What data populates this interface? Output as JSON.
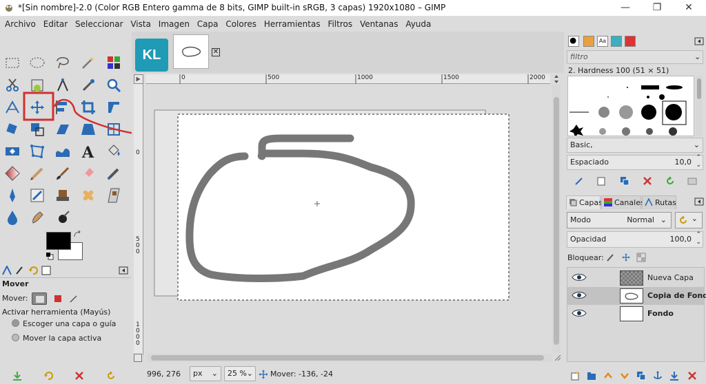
{
  "window": {
    "title": "*[Sin nombre]-2.0 (Color RGB Entero gamma de 8 bits, GIMP built-in sRGB, 3 capas) 1920x1080 – GIMP",
    "minimize": "—",
    "maximize": "❐",
    "close": "✕"
  },
  "menu": [
    "Archivo",
    "Editar",
    "Seleccionar",
    "Vista",
    "Imagen",
    "Capa",
    "Colores",
    "Herramientas",
    "Filtros",
    "Ventanas",
    "Ayuda"
  ],
  "image_tabs": {
    "logo_text": "KL"
  },
  "rulers": {
    "h_ticks": [
      "0",
      "500",
      "1000",
      "1500",
      "2000"
    ],
    "v_ticks": [
      "0",
      "5\n0\n0",
      "1\n0\n0\n0"
    ]
  },
  "tool_options": {
    "title": "Mover",
    "mover_label": "Mover:",
    "toggle_label": "Activar herramienta  (Mayús)",
    "radio1": "Escoger una capa o guía",
    "radio2": "Mover la capa activa"
  },
  "status": {
    "coords": "996, 276",
    "unit": "px",
    "zoom": "25 %",
    "message": "Mover: -136, -24"
  },
  "brushes": {
    "filter_placeholder": "filtro",
    "current": "2. Hardness 100 (51 × 51)",
    "preset": "Basic,",
    "spacing_label": "Espaciado",
    "spacing_value": "10,0"
  },
  "layers": {
    "tabs": [
      "Capas",
      "Canales",
      "Rutas"
    ],
    "mode_label": "Modo",
    "mode_value": "Normal",
    "opacity_label": "Opacidad",
    "opacity_value": "100,0",
    "lock_label": "Bloquear:",
    "items": [
      {
        "name": "Nueva Capa",
        "bold": false,
        "selected": false
      },
      {
        "name": "Copia de Fondo",
        "bold": true,
        "selected": true
      },
      {
        "name": "Fondo",
        "bold": true,
        "selected": false
      }
    ]
  },
  "colors": {
    "accent_red": "#d32f2f",
    "stroke_gray": "#777777",
    "logo_teal": "#1f9bb5"
  }
}
